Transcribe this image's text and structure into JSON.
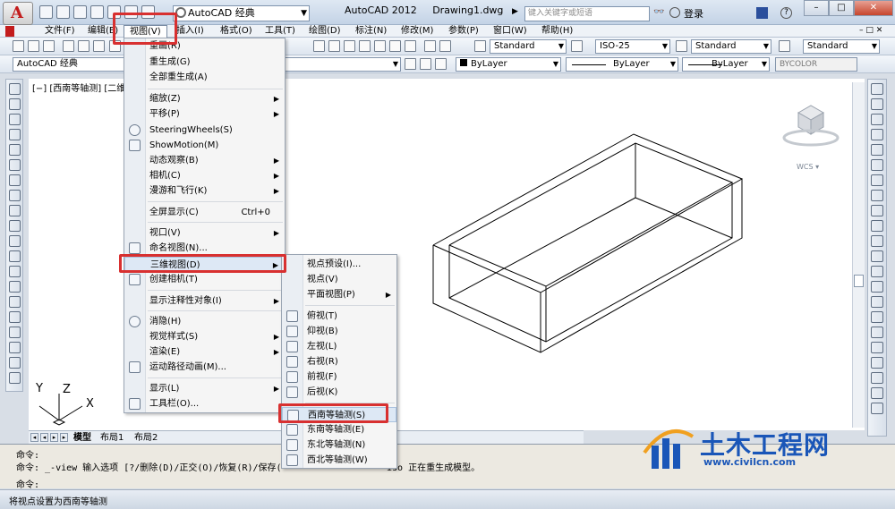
{
  "title_bar": {
    "workspace": "AutoCAD 经典",
    "app_title": "AutoCAD 2012",
    "file_title": "Drawing1.dwg",
    "search_placeholder": "键入关键字或短语",
    "login": "登录"
  },
  "menubar": [
    "文件(F)",
    "编辑(E)",
    "视图(V)",
    "插入(I)",
    "格式(O)",
    "工具(T)",
    "绘图(D)",
    "标注(N)",
    "修改(M)",
    "参数(P)",
    "窗口(W)",
    "帮助(H)"
  ],
  "styles_toolbar": {
    "text_style": "Standard",
    "dim_style": "ISO-25",
    "table_style": "Standard",
    "multileader_style": "Standard"
  },
  "layer_toolbar": {
    "workspace": "AutoCAD 经典",
    "color": "ByLayer",
    "linetype": "ByLayer",
    "lineweight": "ByLayer",
    "plotstyle": "BYCOLOR"
  },
  "viewport_label": "[−] [西南等轴测] [二维线框]",
  "view_menu": {
    "items": [
      {
        "label": "重画(R)",
        "icon": false
      },
      {
        "label": "重生成(G)",
        "icon": false
      },
      {
        "label": "全部重生成(A)",
        "icon": false
      },
      {
        "label": "缩放(Z)",
        "sub": true
      },
      {
        "label": "平移(P)",
        "sub": true
      },
      {
        "label": "SteeringWheels(S)",
        "icon": true
      },
      {
        "label": "ShowMotion(M)",
        "icon": true
      },
      {
        "label": "动态观察(B)",
        "sub": true
      },
      {
        "label": "相机(C)",
        "sub": true
      },
      {
        "label": "漫游和飞行(K)",
        "sub": true
      },
      {
        "label": "全屏显示(C)",
        "accel": "Ctrl+0"
      },
      {
        "label": "视口(V)",
        "sub": true
      },
      {
        "label": "命名视图(N)...",
        "icon": true
      },
      {
        "label": "三维视图(D)",
        "sub": true
      },
      {
        "label": "创建相机(T)",
        "icon": true
      },
      {
        "label": "显示注释性对象(I)",
        "sub": true
      },
      {
        "label": "消隐(H)",
        "icon": true
      },
      {
        "label": "视觉样式(S)",
        "sub": true
      },
      {
        "label": "渲染(E)",
        "sub": true
      },
      {
        "label": "运动路径动画(M)...",
        "icon": true
      },
      {
        "label": "显示(L)",
        "sub": true
      },
      {
        "label": "工具栏(O)...",
        "icon": true
      }
    ]
  },
  "view3d_menu": {
    "items": [
      {
        "label": "视点预设(I)..."
      },
      {
        "label": "视点(V)"
      },
      {
        "label": "平面视图(P)",
        "sub": true
      },
      {
        "label": "俯视(T)"
      },
      {
        "label": "仰视(B)"
      },
      {
        "label": "左视(L)"
      },
      {
        "label": "右视(R)"
      },
      {
        "label": "前视(F)"
      },
      {
        "label": "后视(K)"
      },
      {
        "label": "西南等轴测(S)"
      },
      {
        "label": "东南等轴测(E)"
      },
      {
        "label": "东北等轴测(N)"
      },
      {
        "label": "西北等轴测(W)"
      }
    ]
  },
  "ucs_labels": {
    "z": "Z",
    "y": "Y",
    "x": "X"
  },
  "wcs": "WCS",
  "tabs": [
    "模型",
    "布局1",
    "布局2"
  ],
  "command": {
    "line1": "命令:",
    "line2": "命令: _-view 输入选项 [?/删除(D)/正交(O)/恢复(R)/保存(",
    "line2_tail": "iso 正在重生成模型。",
    "prompt": "命令:"
  },
  "status": "将视点设置为西南等轴测",
  "watermark": {
    "title": "土木工程网",
    "url": "www.civilcn.com"
  }
}
